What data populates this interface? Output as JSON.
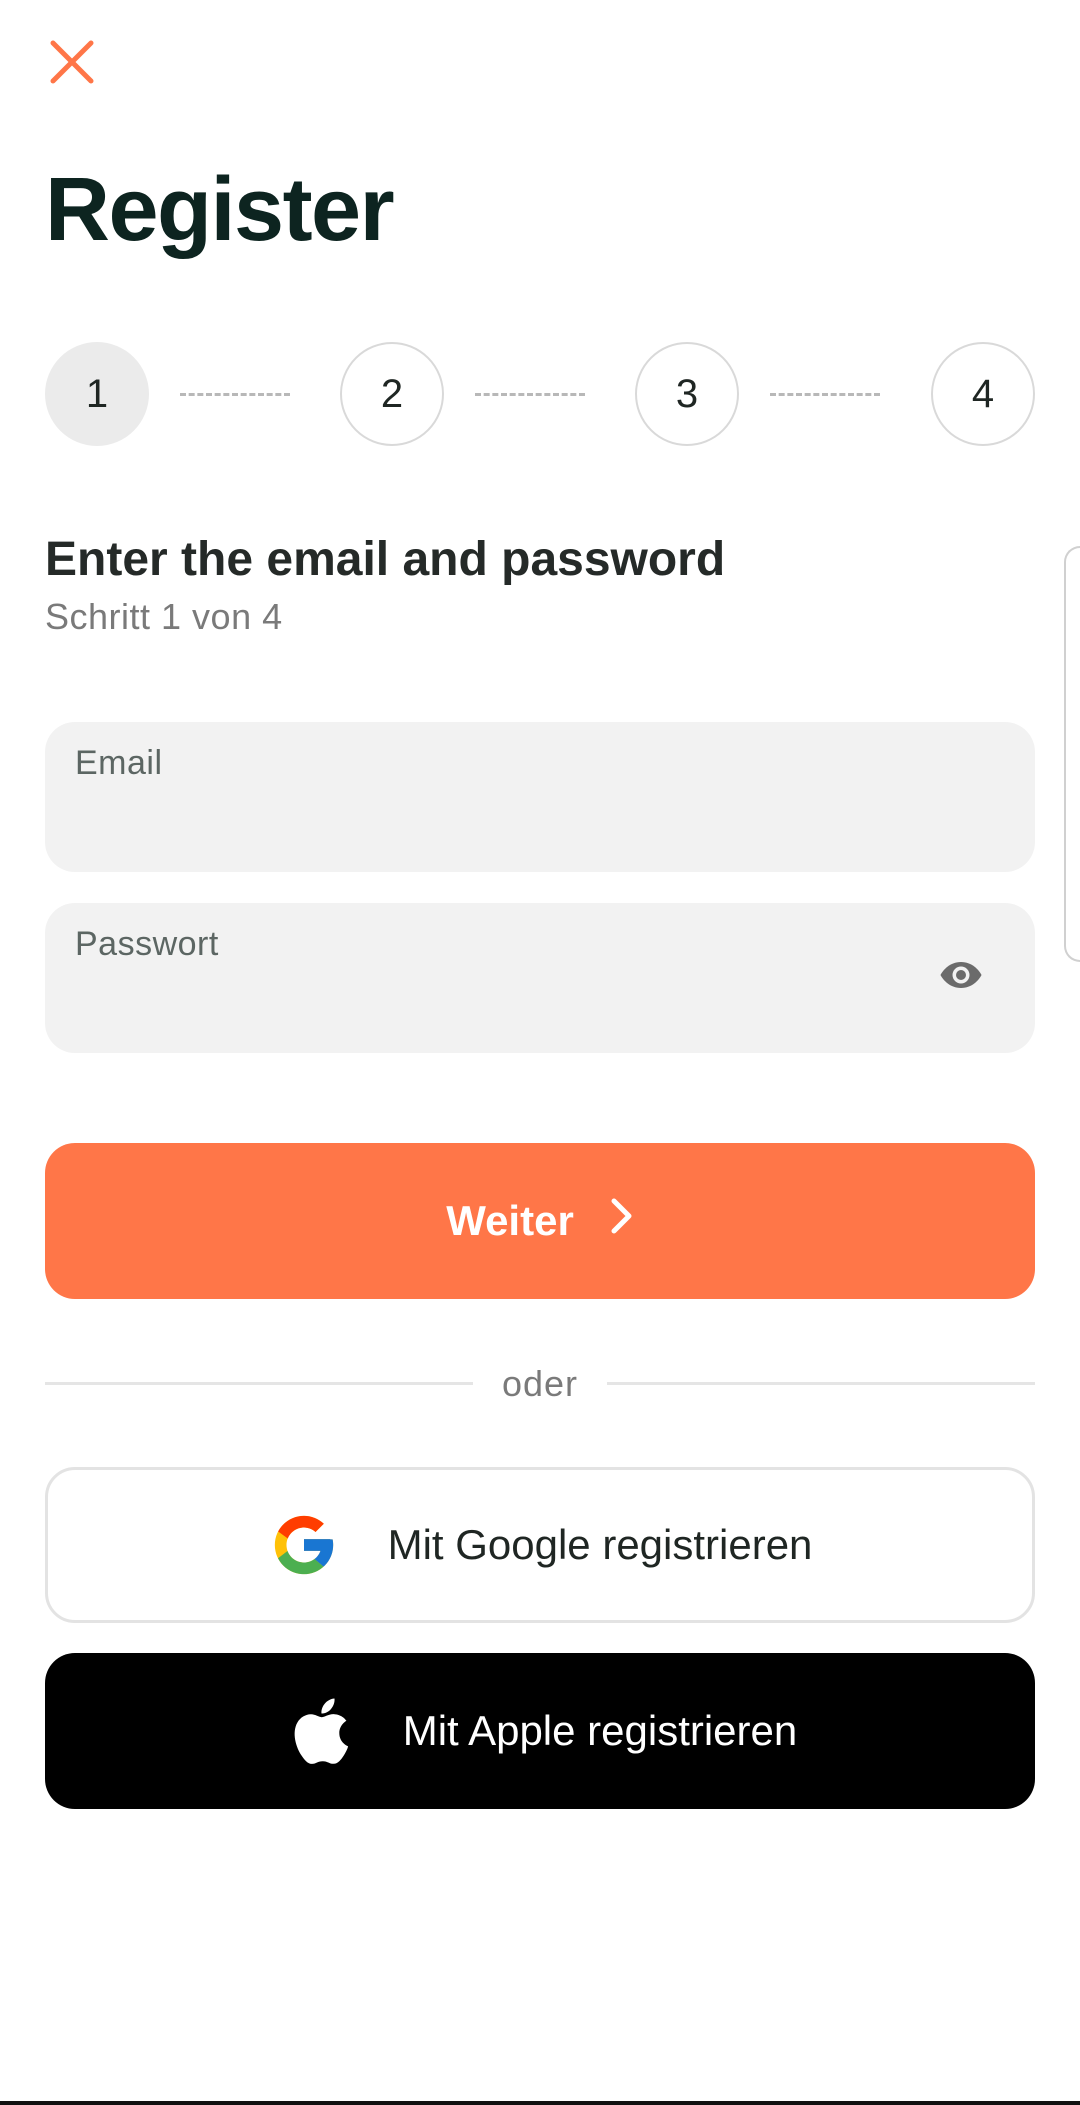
{
  "header": {
    "close_icon": "close-icon",
    "title": "Register"
  },
  "colors": {
    "accent": "#ff7648",
    "title": "#0d2420",
    "field_bg": "#f2f2f2",
    "apple_bg": "#000000"
  },
  "stepper": {
    "current_step": 1,
    "total_steps": 4,
    "steps": [
      {
        "label": "1",
        "active": true
      },
      {
        "label": "2",
        "active": false
      },
      {
        "label": "3",
        "active": false
      },
      {
        "label": "4",
        "active": false
      }
    ]
  },
  "section": {
    "heading": "Enter the email and password",
    "subtitle": "Schritt 1 von 4"
  },
  "form": {
    "email": {
      "label": "Email",
      "value": ""
    },
    "password": {
      "label": "Passwort",
      "value": "",
      "toggle_icon": "eye-icon"
    }
  },
  "primary_button": {
    "label": "Weiter",
    "icon": "chevron-right-icon"
  },
  "divider": {
    "label": "oder"
  },
  "social": {
    "google": {
      "label": "Mit Google registrieren",
      "icon": "google-icon"
    },
    "apple": {
      "label": "Mit Apple registrieren",
      "icon": "apple-icon"
    }
  }
}
